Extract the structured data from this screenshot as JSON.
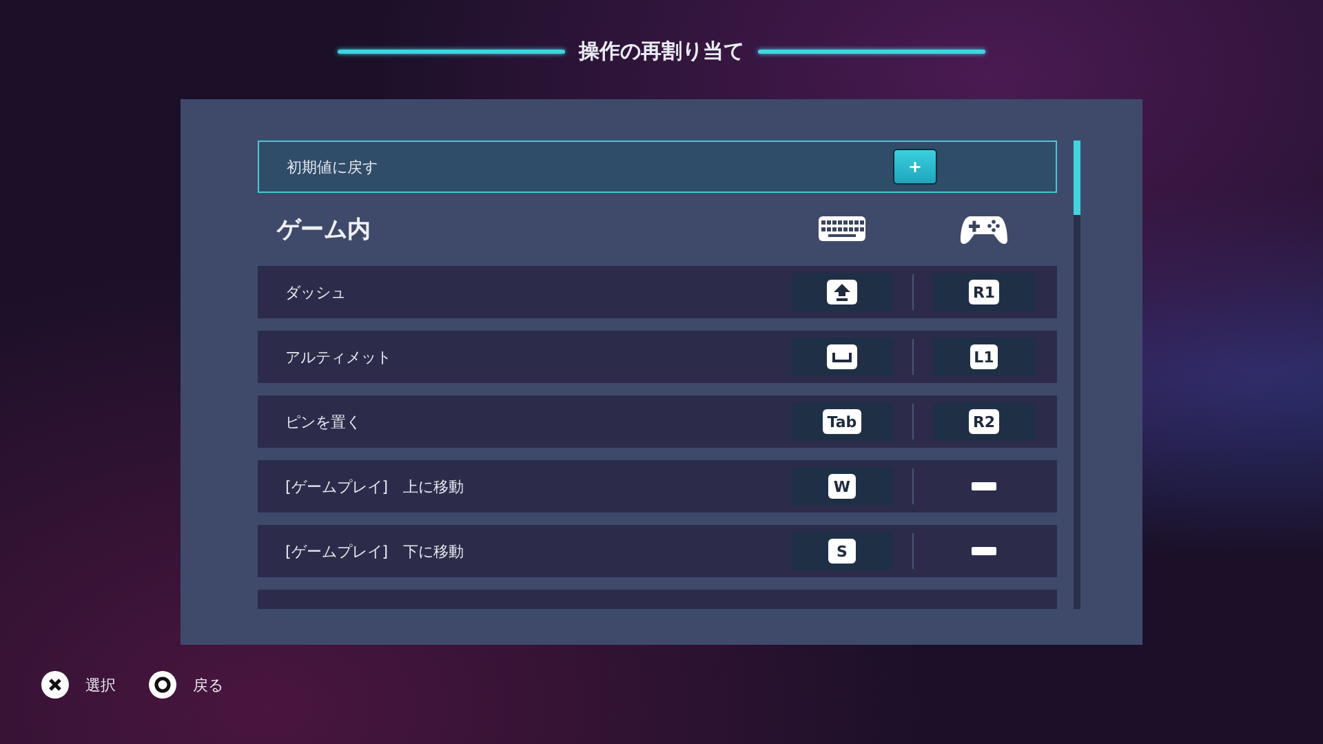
{
  "title": "操作の再割り当て",
  "reset": {
    "label": "初期値に戻す",
    "button": "+"
  },
  "section": {
    "title": "ゲーム内"
  },
  "bindings": [
    {
      "action": "ダッシュ",
      "keyboard": {
        "kind": "shift"
      },
      "controller": {
        "kind": "key",
        "label": "R1"
      }
    },
    {
      "action": "アルティメット",
      "keyboard": {
        "kind": "space"
      },
      "controller": {
        "kind": "key",
        "label": "L1"
      }
    },
    {
      "action": "ピンを置く",
      "keyboard": {
        "kind": "key",
        "label": "Tab"
      },
      "controller": {
        "kind": "key",
        "label": "R2"
      }
    },
    {
      "action": "[ゲームプレイ]　上に移動",
      "keyboard": {
        "kind": "key",
        "label": "W"
      },
      "controller": {
        "kind": "none"
      }
    },
    {
      "action": "[ゲームプレイ]　下に移動",
      "keyboard": {
        "kind": "key",
        "label": "S"
      },
      "controller": {
        "kind": "none"
      }
    }
  ],
  "footer": [
    {
      "kind": "cross",
      "label": "選択"
    },
    {
      "kind": "circle",
      "label": "戻る"
    }
  ]
}
